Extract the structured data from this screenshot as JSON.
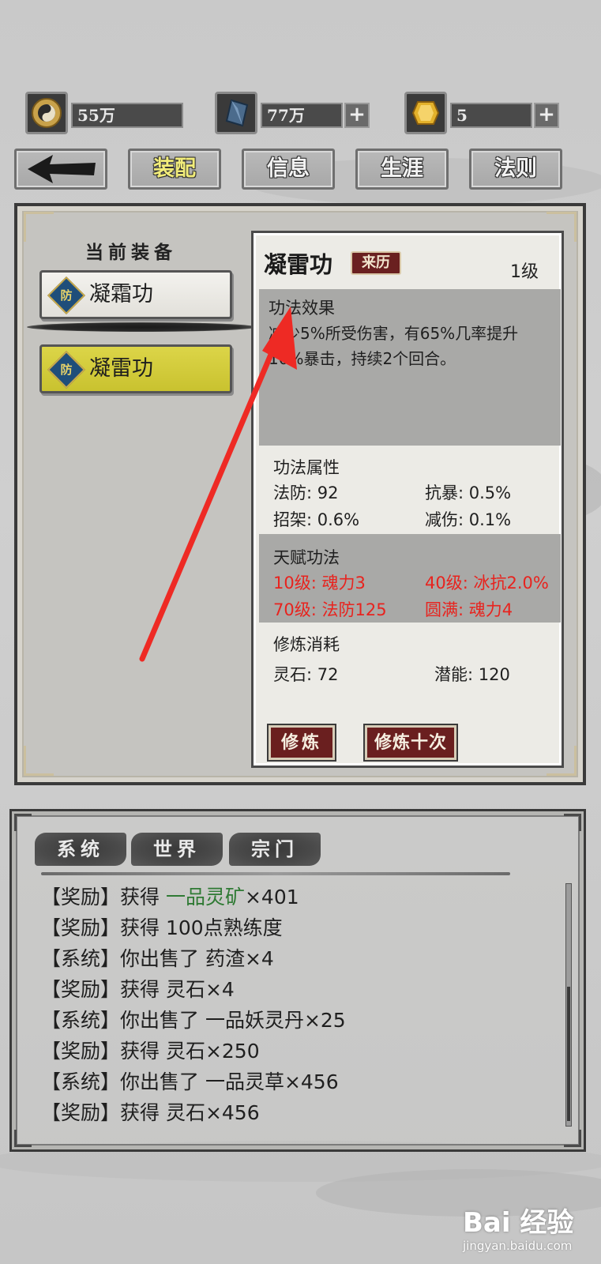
{
  "currencies": [
    {
      "icon": "taiji-icon",
      "value": "55万"
    },
    {
      "icon": "blue-crystal-icon",
      "value": "77万",
      "plus": "+"
    },
    {
      "icon": "gold-gem-icon",
      "value": "5",
      "plus": "+"
    }
  ],
  "nav": {
    "back": "back-arrow-icon",
    "tabs": [
      "装配",
      "信息",
      "生涯",
      "法则"
    ],
    "active": "装配"
  },
  "equip": {
    "title": "当前装备",
    "items": [
      {
        "badge": "防",
        "label": "凝霜功",
        "selected": false
      },
      {
        "badge": "防",
        "label": "凝雷功",
        "selected": true
      }
    ]
  },
  "detail": {
    "name": "凝雷功",
    "source": "来历",
    "level": "1级",
    "effect_title": "功法效果",
    "effect_line1": "减少5%所受伤害，有65%几率提升",
    "effect_line2": "10%暴击，持续2个回合。",
    "attr_title": "功法属性",
    "attrs": [
      {
        "label": "法防: 92"
      },
      {
        "label": "抗暴: 0.5%"
      },
      {
        "label": "招架: 0.6%"
      },
      {
        "label": "减伤: 0.1%"
      }
    ],
    "talent_title": "天赋功法",
    "talents": [
      {
        "label": "10级: 魂力3"
      },
      {
        "label": "40级: 冰抗2.0%"
      },
      {
        "label": "70级: 法防125"
      },
      {
        "label": "圆满: 魂力4"
      }
    ],
    "cost_title": "修炼消耗",
    "costs": [
      {
        "label": "灵石: 72"
      },
      {
        "label": "潜能: 120"
      }
    ],
    "train_btn": "修炼",
    "train10_btn": "修炼十次"
  },
  "chat": {
    "tabs": [
      "系统",
      "世界",
      "宗门"
    ],
    "logs": [
      {
        "prefix": "【奖励】获得 ",
        "item": "一品灵矿",
        "suffix": "×401",
        "green": true
      },
      {
        "text": "【奖励】获得 100点熟练度"
      },
      {
        "text": "【系统】你出售了 药渣×4"
      },
      {
        "text": "【奖励】获得 灵石×4"
      },
      {
        "text": "【系统】你出售了 一品妖灵丹×25"
      },
      {
        "text": "【奖励】获得 灵石×250"
      },
      {
        "text": "【系统】你出售了 一品灵草×456"
      },
      {
        "text": "【奖励】获得 灵石×456"
      }
    ]
  },
  "watermark": {
    "logo": "Bai 经验",
    "url": "jingyan.baidu.com"
  },
  "colors": {
    "talent_red": "#e8231e",
    "item_green": "#2f7a34",
    "button_red": "#6a1f1f",
    "selected_yellow": "#d4cd3c"
  }
}
